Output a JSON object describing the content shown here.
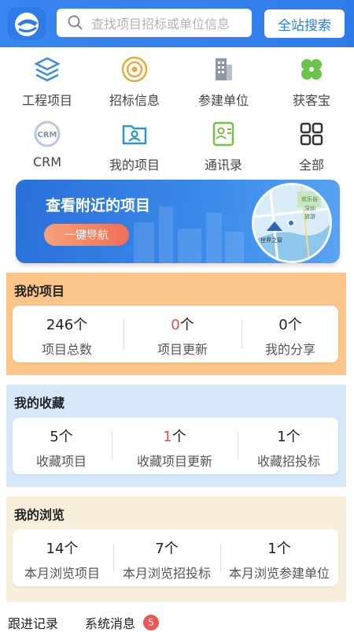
{
  "header": {
    "search_placeholder": "查找项目招标或单位信息",
    "search_button": "全站搜索"
  },
  "grid": [
    {
      "label": "工程项目",
      "icon": "layers-icon"
    },
    {
      "label": "招标信息",
      "icon": "target-icon"
    },
    {
      "label": "参建单位",
      "icon": "building-icon"
    },
    {
      "label": "获客宝",
      "icon": "clover-icon"
    },
    {
      "label": "CRM",
      "icon": "crm-icon"
    },
    {
      "label": "我的项目",
      "icon": "folder-user-icon"
    },
    {
      "label": "通讯录",
      "icon": "contacts-icon"
    },
    {
      "label": "全部",
      "icon": "apps-grid-icon"
    }
  ],
  "banner": {
    "title": "查看附近的项目",
    "button": "一键导航",
    "map_labels": [
      "欢乐谷",
      "深圳",
      "旅游",
      "世界之窗"
    ]
  },
  "my_projects": {
    "title": "我的项目",
    "stats": [
      {
        "value": "246",
        "unit": "个",
        "label": "项目总数"
      },
      {
        "value": "0",
        "unit": "个",
        "label": "项目更新"
      },
      {
        "value": "0",
        "unit": "个",
        "label": "我的分享"
      }
    ]
  },
  "my_favorites": {
    "title": "我的收藏",
    "stats": [
      {
        "value": "5",
        "unit": "个",
        "label": "收藏项目"
      },
      {
        "value": "1",
        "unit": "个",
        "label": "收藏项目更新"
      },
      {
        "value": "1",
        "unit": "个",
        "label": "收藏招投标"
      }
    ]
  },
  "my_browsing": {
    "title": "我的浏览",
    "stats": [
      {
        "value": "14",
        "unit": "个",
        "label": "本月浏览项目"
      },
      {
        "value": "7",
        "unit": "个",
        "label": "本月浏览招投标"
      },
      {
        "value": "1",
        "unit": "个",
        "label": "本月浏览参建单位"
      }
    ]
  },
  "bottom_tabs": {
    "follow": "跟进记录",
    "messages": "系统消息",
    "message_count": "5"
  },
  "colors": {
    "header_blue": "#2f7be8",
    "projects_bg": "#fac588",
    "favorites_bg": "#d6e7fa",
    "browsing_bg": "#f7eedb",
    "accent_red": "#e0504a"
  }
}
